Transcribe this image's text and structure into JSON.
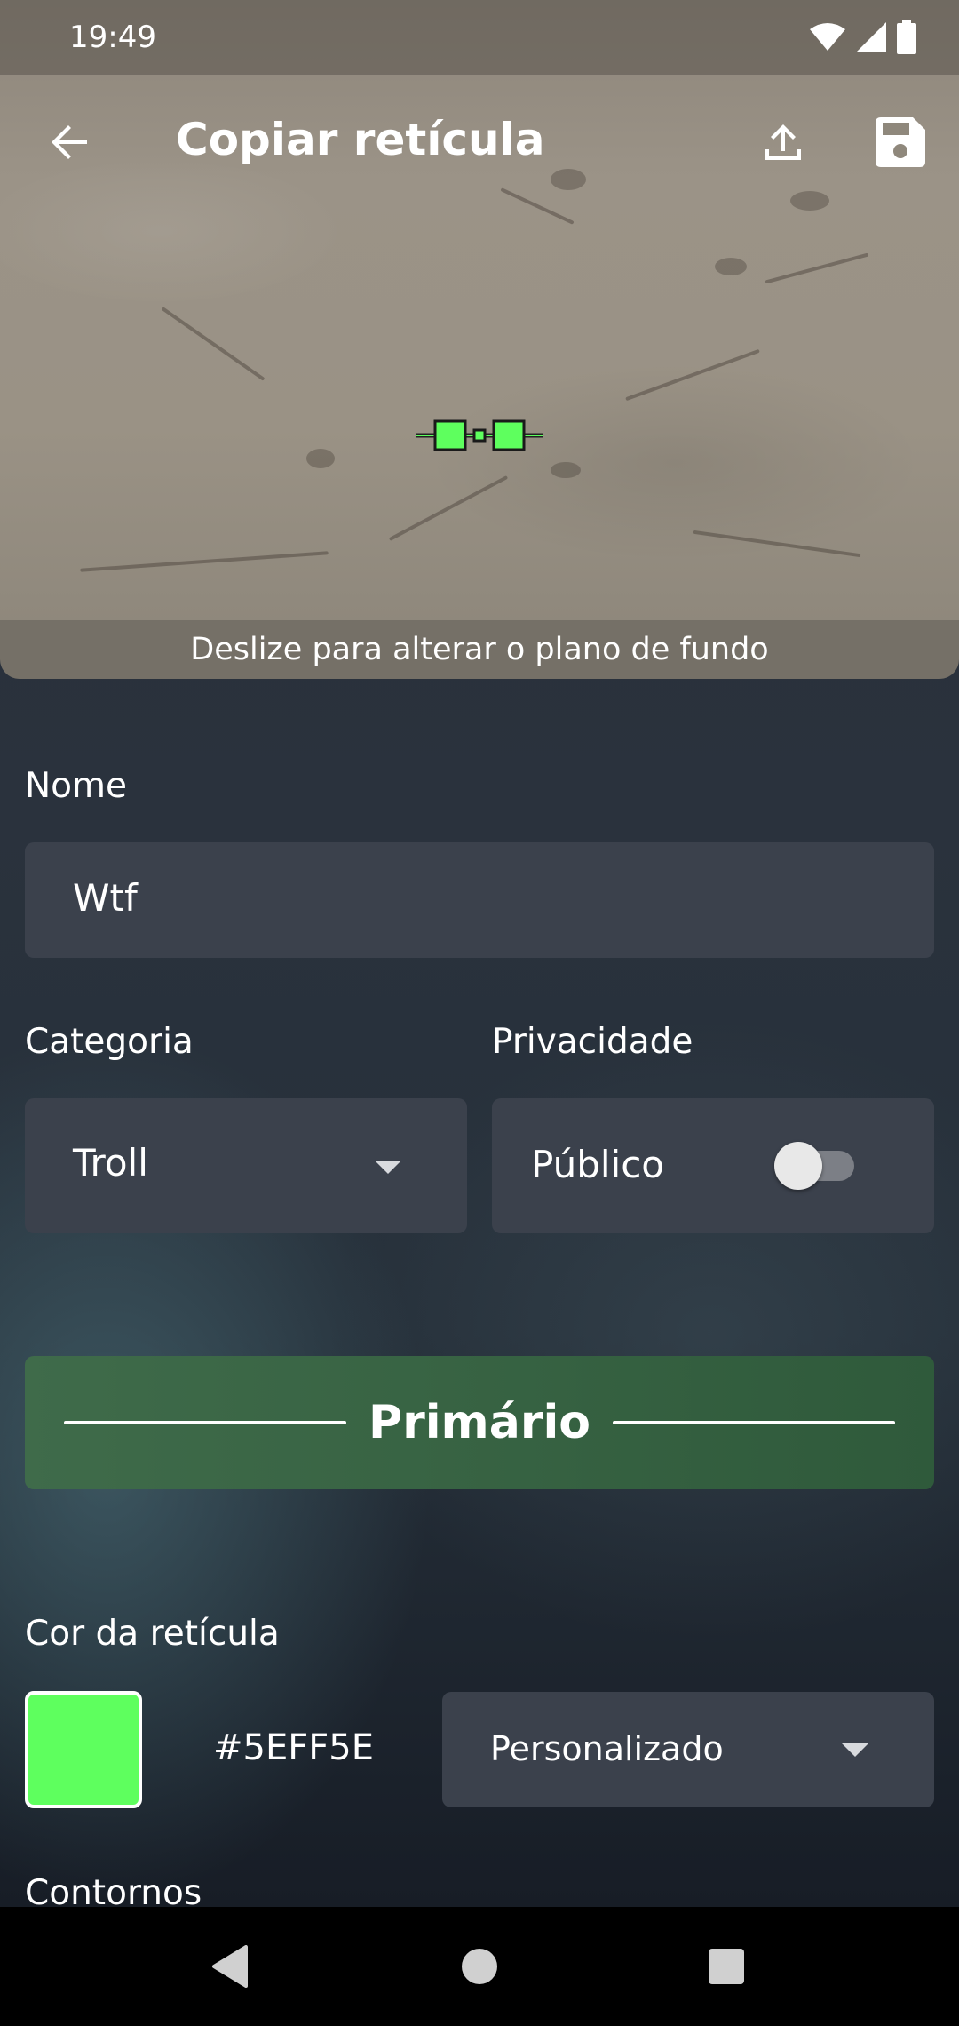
{
  "status_bar": {
    "time": "19:49",
    "icons": [
      "wifi-icon",
      "signal-icon",
      "battery-icon"
    ]
  },
  "app_bar": {
    "title": "Copiar retícula",
    "back_icon": "arrow-back-icon",
    "actions": [
      "upload-icon",
      "save-icon"
    ]
  },
  "preview": {
    "swipe_hint": "Deslize para alterar o plano de fundo",
    "reticle_color": "#5EFF5E"
  },
  "form": {
    "name": {
      "label": "Nome",
      "value": "Wtf"
    },
    "category": {
      "label": "Categoria",
      "value": "Troll"
    },
    "privacy": {
      "label": "Privacidade",
      "value": "Público",
      "enabled": false
    },
    "section_primary": "Primário",
    "reticle_color": {
      "label": "Cor da retícula",
      "hex": "#5EFF5E",
      "swatch": "#5EFF5E",
      "preset": "Personalizado"
    },
    "outlines_label": "Contornos"
  },
  "colors": {
    "primary_banner": "#3f6b4a",
    "field_bg": "#3b414c"
  },
  "nav_bar": [
    "back-triangle-icon",
    "home-circle-icon",
    "recents-square-icon"
  ]
}
